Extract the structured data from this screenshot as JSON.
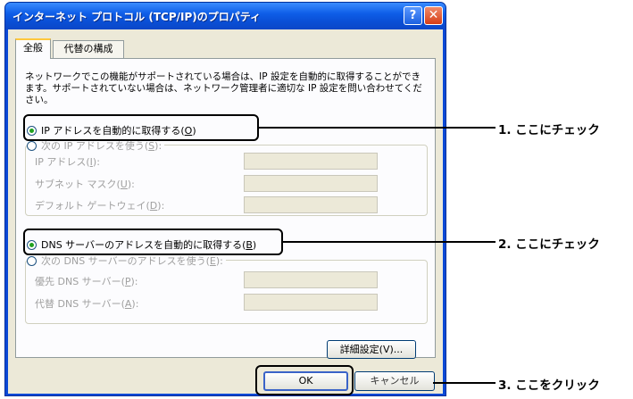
{
  "window": {
    "title": "インターネット プロトコル (TCP/IP)のプロパティ",
    "help_glyph": "?",
    "close_glyph": "✕"
  },
  "tabs": [
    {
      "label": "全般",
      "selected": true
    },
    {
      "label": "代替の構成",
      "selected": false
    }
  ],
  "description": "ネットワークでこの機能がサポートされている場合は、IP 設定を自動的に取得することができます。サポートされていない場合は、ネットワーク管理者に適切な IP 設定を問い合わせてください。",
  "ip": {
    "auto": {
      "label": "IP アドレスを自動的に取得する",
      "mnemonic": "O",
      "selected": true
    },
    "manual": {
      "label": "次の IP アドレスを使う",
      "mnemonic": "S",
      "selected": false
    },
    "fields": [
      {
        "label": "IP アドレス",
        "mnemonic": "I",
        "value": ""
      },
      {
        "label": "サブネット マスク",
        "mnemonic": "U",
        "value": ""
      },
      {
        "label": "デフォルト ゲートウェイ",
        "mnemonic": "D",
        "value": ""
      }
    ]
  },
  "dns": {
    "auto": {
      "label": "DNS サーバーのアドレスを自動的に取得する",
      "mnemonic": "B",
      "selected": true
    },
    "manual": {
      "label": "次の DNS サーバーのアドレスを使う",
      "mnemonic": "E",
      "selected": false
    },
    "fields": [
      {
        "label": "優先 DNS サーバー",
        "mnemonic": "P",
        "value": ""
      },
      {
        "label": "代替 DNS サーバー",
        "mnemonic": "A",
        "value": ""
      }
    ]
  },
  "buttons": {
    "advanced": "詳細設定(V)...",
    "ok": "OK",
    "cancel": "キャンセル"
  },
  "callouts": [
    "1. ここにチェック",
    "2. ここにチェック",
    "3. ここをクリック"
  ],
  "colors": {
    "title_bar": "#0a4fd6",
    "dialog_bg": "#ece9d8",
    "radio_dot": "#21a121",
    "callout": "#000000"
  }
}
